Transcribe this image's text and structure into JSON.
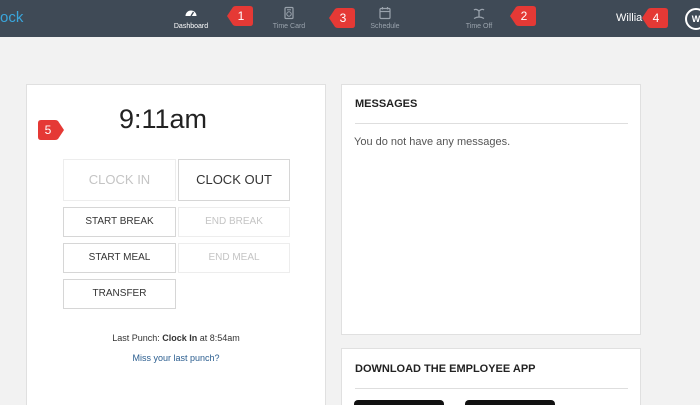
{
  "nav": {
    "brand_partial": "ock",
    "items": [
      {
        "label": "Dashboard",
        "icon": "gauge-icon",
        "active": true
      },
      {
        "label": "Time Card",
        "icon": "timecard-icon",
        "active": false
      },
      {
        "label": "Schedule",
        "icon": "calendar-icon",
        "active": false
      },
      {
        "label": "Time Off",
        "icon": "island-icon",
        "active": false
      }
    ],
    "user_name": "Willia       h",
    "avatar_initials": "W"
  },
  "markers": [
    "1",
    "2",
    "3",
    "4",
    "5"
  ],
  "clock": {
    "time": "9:11am",
    "buttons": {
      "clock_in": "CLOCK IN",
      "clock_out": "CLOCK OUT",
      "start_break": "START BREAK",
      "end_break": "END BREAK",
      "start_meal": "START MEAL",
      "end_meal": "END MEAL",
      "transfer": "TRANSFER"
    },
    "last_punch_prefix": "Last Punch: ",
    "last_punch_action": "Clock In",
    "last_punch_suffix": " at 8:54am",
    "miss_link": "Miss your last punch?"
  },
  "messages": {
    "title": "MESSAGES",
    "empty_text": "You do not have any messages."
  },
  "app_download": {
    "title": "DOWNLOAD THE EMPLOYEE APP"
  },
  "colors": {
    "topbar": "#3f4a56",
    "marker": "#e53935",
    "link": "#2a5d8f",
    "accent": "#3aa6dc"
  }
}
